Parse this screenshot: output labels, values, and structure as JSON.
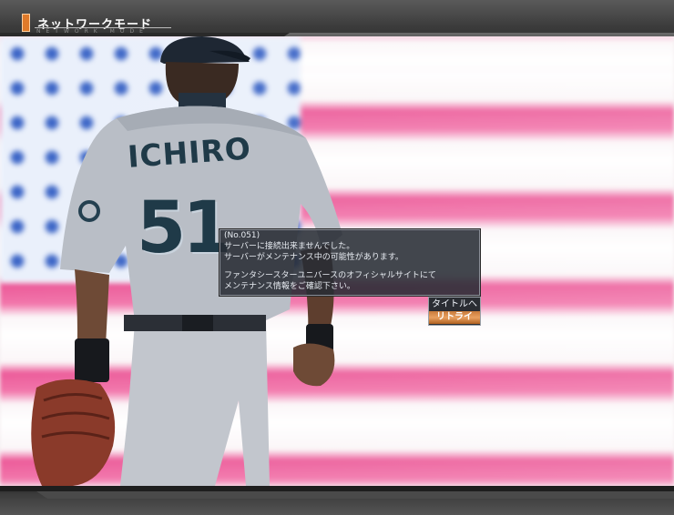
{
  "header": {
    "title": "ネットワークモード",
    "subtitle": "NETWORK MODE"
  },
  "photo": {
    "jersey_name": "ICHIRO",
    "jersey_number": "51"
  },
  "dialog": {
    "lines": [
      "(No.051)",
      "サーバーに接続出来ませんでした。",
      "サーバーがメンテナンス中の可能性があります。",
      "",
      "ファンタシースターユニバースのオフィシャルサイトにて",
      "メンテナンス情報をご確認下さい。"
    ]
  },
  "buttons": {
    "to_title": "タイトルへ",
    "retry": "リトライ"
  },
  "colors": {
    "accent": "#e07a2a",
    "stripe": "#ec5c9a",
    "canton": "#3a64c6",
    "jersey": "#b9bec6",
    "lettering": "#1f3a48"
  }
}
